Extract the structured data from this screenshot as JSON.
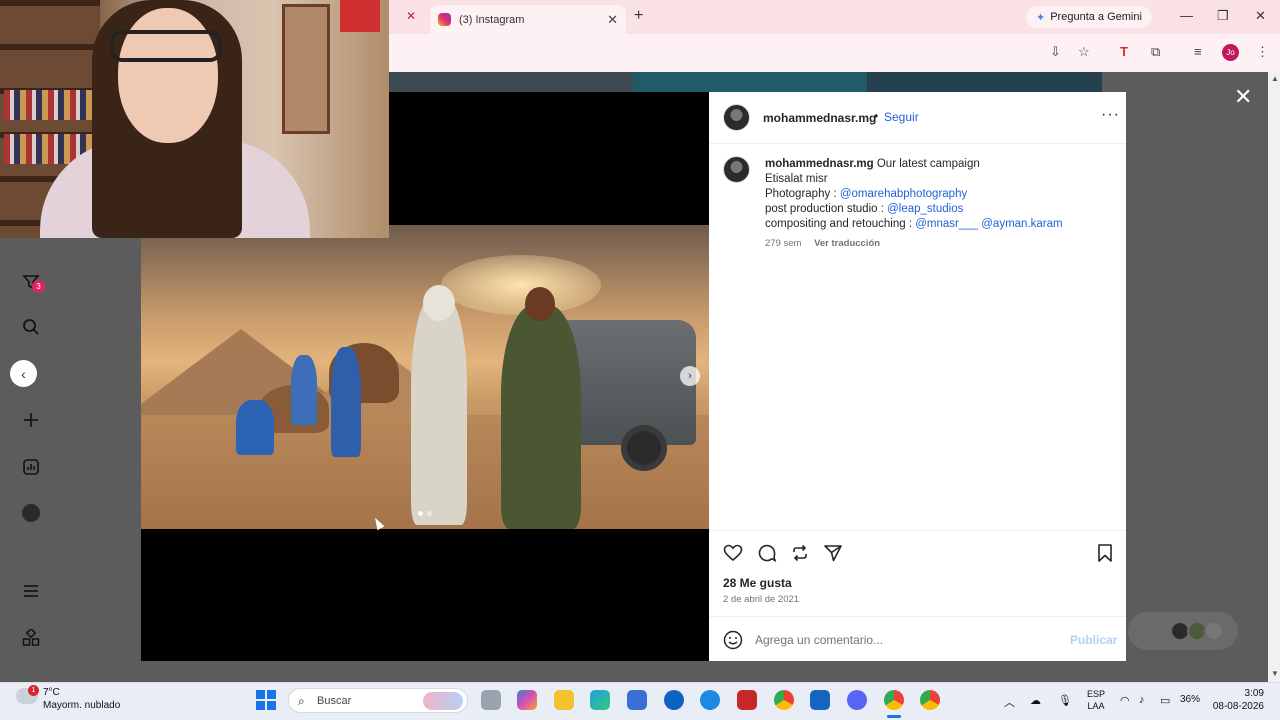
{
  "browser": {
    "tab_title": "(3) Instagram",
    "gemini_label": "Pregunta a Gemini",
    "profile_initials": "Jo",
    "accent": "#f9e1e6"
  },
  "post": {
    "username": "mohammednasr.mg",
    "follow_label": "Seguir",
    "caption": {
      "user": "mohammednasr.mg",
      "line1": "Our latest campaign",
      "line2": "Etisalat misr",
      "line3_prefix": "Photography : ",
      "line3_link": "@omarehabphotography",
      "line4_prefix": "post production studio : ",
      "line4_link": "@leap_studios",
      "line5_prefix": "compositing and retouching : ",
      "line5_link1": "@mnasr___",
      "line5_link2": "@ayman.karam"
    },
    "age": "279 sem",
    "translate_label": "Ver traducción",
    "likes": "28 Me gusta",
    "date": "2 de abril de 2021",
    "comment_placeholder": "Agrega un comentario...",
    "publish_label": "Publicar",
    "carousel": {
      "current": 1,
      "total": 2
    }
  },
  "sidebar": {
    "notification_count": "3"
  },
  "taskbar": {
    "weather_badge": "1",
    "temperature": "7°C",
    "condition": "Mayorm. nublado",
    "search_placeholder": "Buscar",
    "language_line1": "ESP",
    "language_line2": "LAA",
    "battery": "36%",
    "time": "3:09",
    "date": "08-08-2026"
  }
}
